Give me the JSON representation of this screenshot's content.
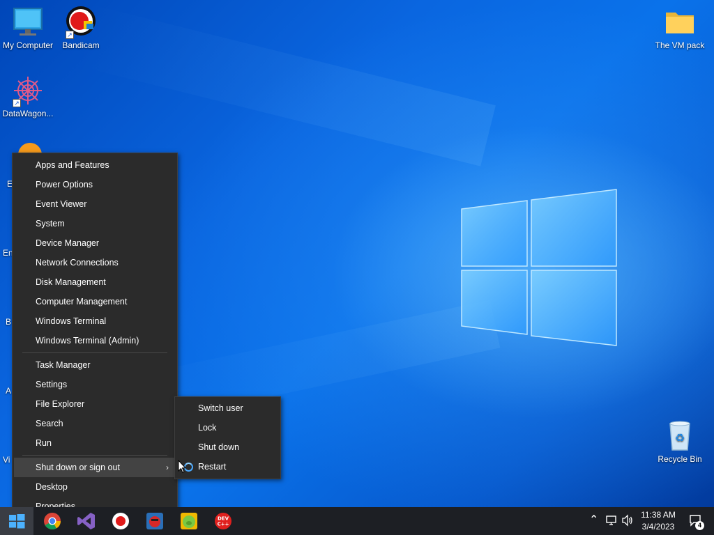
{
  "desktop": {
    "icons": [
      {
        "label": "My Computer"
      },
      {
        "label": "Bandicam"
      },
      {
        "label": "DataWagon..."
      },
      {
        "label": "The VM pack"
      },
      {
        "label": "Recycle Bin"
      }
    ],
    "partial_labels": [
      "E",
      "En",
      "B",
      "A",
      "Vi"
    ]
  },
  "context_menu": {
    "group1": [
      "Apps and Features",
      "Power Options",
      "Event Viewer",
      "System",
      "Device Manager",
      "Network Connections",
      "Disk Management",
      "Computer Management",
      "Windows Terminal",
      "Windows Terminal (Admin)"
    ],
    "group2": [
      "Task Manager",
      "Settings",
      "File Explorer",
      "Search",
      "Run"
    ],
    "group3": [
      "Shut down or sign out",
      "Desktop",
      "Properties"
    ]
  },
  "submenu": {
    "items": [
      "Switch user",
      "Lock",
      "Shut down",
      "Restart"
    ]
  },
  "taskbar": {
    "time": "11:38 AM",
    "date": "3/4/2023",
    "notification_count": "4",
    "apps": [
      "start-icon",
      "chrome-icon",
      "visual-studio-icon",
      "bandicam-icon",
      "angry-birds-icon",
      "pig-game-icon",
      "dev-cpp-icon"
    ]
  },
  "colors": {
    "menu_bg": "#2b2b2b",
    "menu_hover": "#434343",
    "taskbar_bg": "#1d1f24",
    "accent": "#4aa9ff"
  }
}
